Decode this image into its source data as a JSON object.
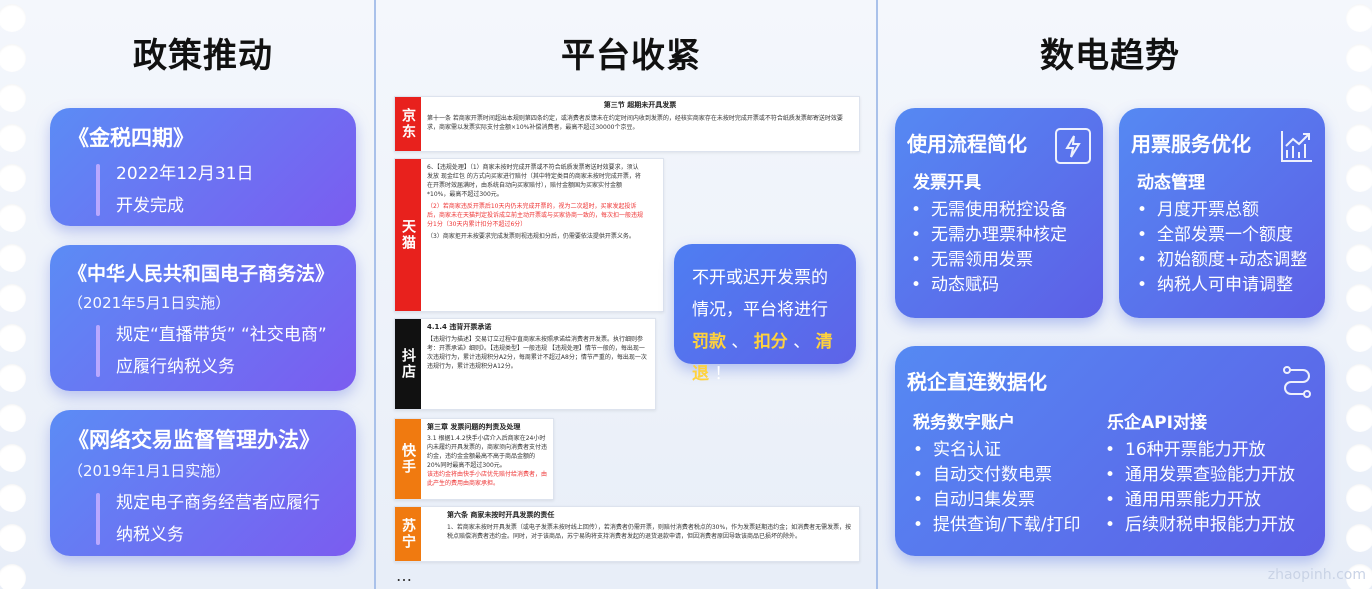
{
  "columns": {
    "left_title": "政策推动",
    "middle_title": "平台收紧",
    "right_title": "数电趋势"
  },
  "left_cards": [
    {
      "title": "《金税四期》",
      "subtitle": "",
      "lines": [
        "2022年12月31日",
        "开发完成"
      ]
    },
    {
      "title": "《中华人民共和国电子商务法》",
      "subtitle": "（2021年5月1日实施）",
      "lines": [
        "规定“直播带货”  “社交电商”",
        "应履行纳税义务"
      ]
    },
    {
      "title": "《网络交易监督管理办法》",
      "subtitle": "（2019年1月1日实施）",
      "lines": [
        "规定电子商务经营者应履行",
        "纳税义务"
      ]
    }
  ],
  "platforms": [
    {
      "name": "京东",
      "color": "#e8211d",
      "heading": "第三节 超期未开具发票",
      "text": "第十一条 若商家开票时间超出本规则第四条约定，或消费者反馈未在约定时间内收到发票的，经核实商家存在未按时完成开票或不符合纸质发票邮寄送时效要求，商家需以发票实际支付金额×10%补偿消费者，最高不超过30000个京豆。"
    },
    {
      "name": "天猫",
      "color": "#e8211d",
      "heading": "",
      "text": "6、【违规处理】（1）商家未按时完成开票或不符合纸质发票寄送时效要求，须认发放 现金红包 的方式向买家进行赔付（其中特定类目的商家未按时完成开票，将在开票时效届满时，由系统自动向买家赔付），赔付金额国为买家实付金额*10%，最高不超过300元。",
      "red_text": "（2）若商家违反开票后10天内仍未完成开票的，视为二次超时，买家发起投诉后，商家未在天猫判定投诉成立前主动开票或与买家协商一致的，每次扣一般违规分1分（30天内累计扣分不超过6分）",
      "tail": "（3）商家拒开未按要求完成发票则视违规扣分后，仍需要依法提供开票义务。"
    },
    {
      "name": "抖店",
      "color": "#111111",
      "heading": "4.1.4 违背开票承诺",
      "text": "【违规行为描述】交易订立过程中直商家未按照承诺给消费者开发票。执行细则参考：开票承诺》细则》。【违规类型】一般违规 【违规处理】情节一般的，每出现一次违规行为，累计违规积分A2分，每周累计不超过A8分；情节严重的，每出现一次违规行为，累计违规积分A12分。"
    },
    {
      "name": "快手",
      "color": "#f07a10",
      "heading": "第三章 发票问题的判责及处理",
      "text": "3.1 根据1.4.2快手小店介入后商家在24小时内未履约开具发票的，商家须向消费者支付违约金，违约金金额最高不高于商品金额的20%同时最高不超过300元。",
      "red_text": "该违约金将由快手小店优先赔付给消费者，由此产生的费用由商家承担。"
    },
    {
      "name": "苏宁",
      "color": "#f07a10",
      "heading": "第六条 商家未按时开具发票的责任",
      "text": "1、若商家未按时开具发票（或电子发票未按时线上回传），若消费者仍需开票，则赔付消费者税点的30%，作为发票延期违约金；如消费者无需发票，按税点赔偿消费者违约金。同时，对于该商品，苏宁易购将支持消费者发起的退货退款申请，但因消费者原因导致该商品已损坏的除外。"
    }
  ],
  "ellipsis": "…",
  "callout": {
    "line1": "不开或迟开发票的",
    "line2": "情况，平台将进行",
    "kw1": "罚款",
    "sep1": "、",
    "kw2": "扣分",
    "sep2": "、",
    "kw3": "清退",
    "end": "！"
  },
  "right_cards": {
    "simplify": {
      "title": "使用流程简化",
      "icon": "lightning-card-icon",
      "section": "发票开具",
      "items": [
        "无需使用税控设备",
        "无需办理票种核定",
        "无需领用发票",
        "动态赋码"
      ]
    },
    "service": {
      "title": "用票服务优化",
      "icon": "growth-chart-icon",
      "section": "动态管理",
      "items": [
        "月度开票总额",
        "全部发票一个额度",
        "初始额度+动态调整",
        "纳税人可申请调整"
      ]
    },
    "direct": {
      "title": "税企直连数据化",
      "icon": "route-s-icon",
      "section_left": "税务数字账户",
      "items_left": [
        "实名认证",
        "自动交付数电票",
        "自动归集发票",
        "提供查询/下载/打印"
      ],
      "section_right": "乐企API对接",
      "items_right": [
        "16种开票能力开放",
        "通用发票查验能力开放",
        "通用用票能力开放",
        "后续财税申报能力开放"
      ]
    }
  },
  "watermark": "zhaopinh.com"
}
